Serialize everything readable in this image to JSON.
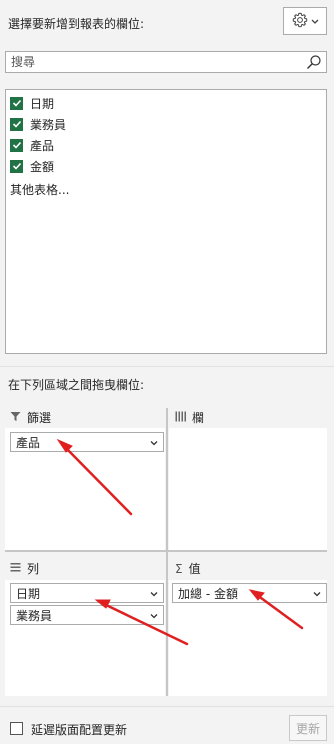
{
  "header": {
    "title": "選擇要新增到報表的欄位:",
    "gear_icon": "gear-icon"
  },
  "search": {
    "placeholder": "搜尋"
  },
  "fields": [
    {
      "label": "日期",
      "checked": true
    },
    {
      "label": "業務員",
      "checked": true
    },
    {
      "label": "產品",
      "checked": true
    },
    {
      "label": "金額",
      "checked": true
    }
  ],
  "more_tables": "其他表格...",
  "areas": {
    "title": "在下列區域之間拖曳欄位:",
    "filters": {
      "label": "篩選",
      "items": [
        "產品"
      ]
    },
    "columns": {
      "label": "欄",
      "items": []
    },
    "rows": {
      "label": "列",
      "items": [
        "日期",
        "業務員"
      ]
    },
    "values": {
      "label": "值",
      "items": [
        "加總 - 金額"
      ]
    }
  },
  "footer": {
    "defer_label": "延遲版面配置更新",
    "update_label": "更新"
  },
  "colors": {
    "checkbox": "#217346",
    "annotation_arrow": "#e02020"
  }
}
